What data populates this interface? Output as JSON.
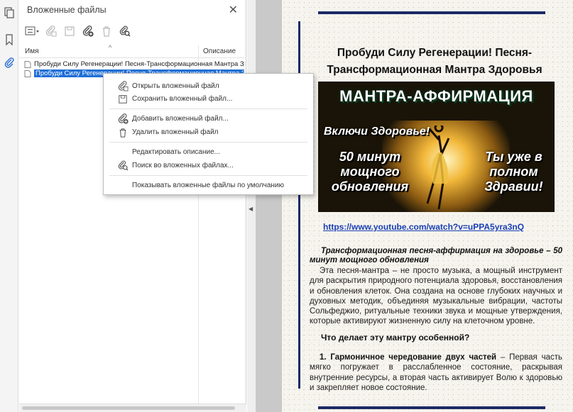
{
  "rail": {
    "icons": [
      "pages-icon",
      "bookmark-icon",
      "paperclip-icon"
    ]
  },
  "panel": {
    "title": "Вложенные файлы",
    "columns": {
      "name": "Имя",
      "description": "Описание"
    },
    "files": [
      {
        "name": "Пробуди Силу Регенерации! Песня-Трансформационная Мантра Здоровья",
        "selected": false
      },
      {
        "name": "Пробуди Силу Регенерации! Песня-Трансформационная Мантра Здоровья",
        "selected": true
      }
    ]
  },
  "context_menu": {
    "open": "Открыть вложенный файл",
    "save": "Сохранить вложенный файл...",
    "add": "Добавить вложенный файл...",
    "delete": "Удалить вложенный файл",
    "edit_description": "Редактировать описание...",
    "search": "Поиск во вложенных файлах...",
    "show_default": "Показывать вложенные файлы по умолчанию"
  },
  "document": {
    "title": "Пробуди Силу Регенерации! Песня-Трансформационная Мантра Здоровья",
    "banner": {
      "headline": "МАНТРА-АФФИРМАЦИЯ",
      "left_top": "Включи Здоровье!",
      "left_main": "50 минут мощного обновления",
      "right_main": "Ты уже в полном Здравии!"
    },
    "link": "https://www.youtube.com/watch?v=uPPA5yra3nQ",
    "lead": "Трансформационная песня-аффирмация на здоровье – 50 минут мощного обновления",
    "body1": "Эта песня-мантра – не просто музыка, а мощный инструмент для раскрытия природного потенциала здоровья, восстановления и обновления клеток. Она создана на основе глубоких научных и духовных методик, объединяя музыкальные вибрации, частоты Сольфеджио, ритуальные техники звука и мощные утверждения, которые активируют жизненную силу на клеточном уровне.",
    "question": "Что делает эту мантру особенной?",
    "point1_bold": "1. Гармоничное чередование двух частей",
    "point1_rest": " – Первая часть мягко погружает в расслабленное состояние, раскрывая внутренние ресурсы, а вторая часть активирует Волю к здоровью и закрепляет новое состояние."
  },
  "colors": {
    "selection": "#1f6fd6",
    "rule": "#1c2a66",
    "link": "#1a3fb5"
  }
}
